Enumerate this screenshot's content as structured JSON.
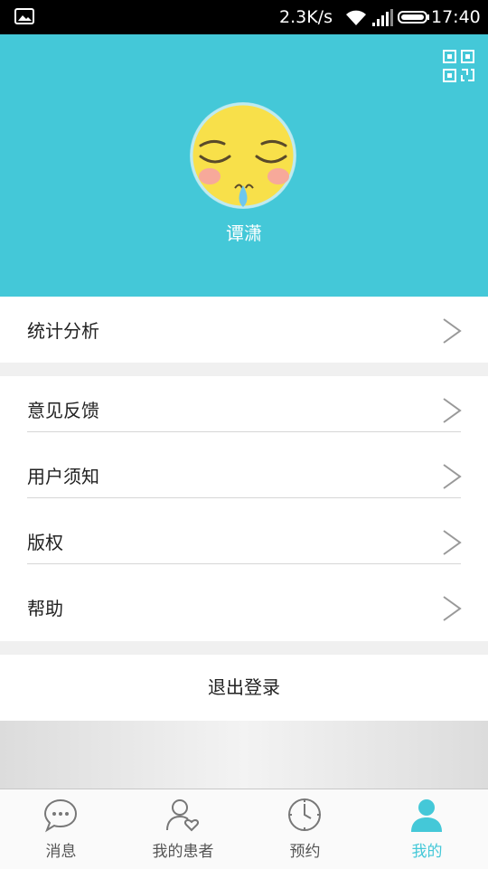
{
  "status_bar": {
    "speed": "2.3K/s",
    "time": "17:40",
    "icons": [
      "image-icon",
      "wifi-icon",
      "signal-icon",
      "battery-icon"
    ]
  },
  "profile": {
    "name": "谭潇",
    "qr_icon": "qr-code-icon",
    "avatar": "sleepy-emoji-avatar"
  },
  "menu": {
    "stats": "统计分析",
    "items": [
      "意见反馈",
      "用户须知",
      "版权",
      "帮助"
    ]
  },
  "logout_label": "退出登录",
  "tabs": [
    {
      "label": "消息",
      "icon": "chat-bubble-icon"
    },
    {
      "label": "我的患者",
      "icon": "patient-heart-icon"
    },
    {
      "label": "预约",
      "icon": "clock-icon"
    },
    {
      "label": "我的",
      "icon": "person-icon"
    }
  ],
  "colors": {
    "accent": "#44c8d8",
    "background": "#f0f0f0",
    "text": "#222222"
  }
}
